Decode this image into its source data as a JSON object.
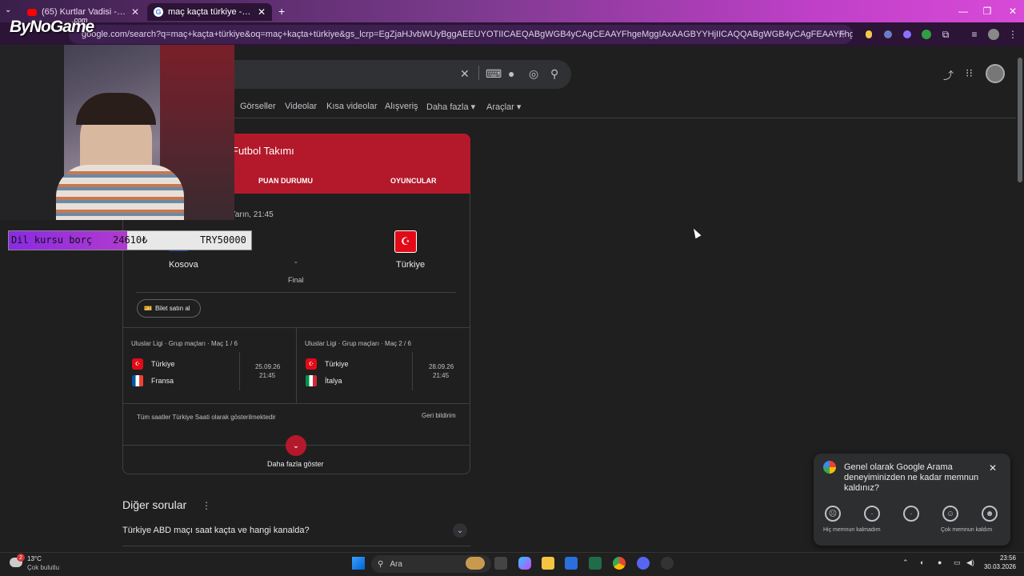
{
  "browser": {
    "tabs": [
      {
        "title": "(65) Kurtlar Vadisi - 66. Bölüm | ..."
      },
      {
        "title": "maç kaçta türkiye - Google'da A..."
      }
    ],
    "new_tab_symbol": "+",
    "url": "google.com/search?q=maç+kaçta+türkiye&oq=maç+kaçta+türkiye&gs_lcrp=EgZjaHJvbWUyBggAEEUYOTIICAEQABgWGB4yCAgCEAAYFhgeMggIAxAAGBYYHjIICAQQABgWGB4yCAgFEAAYFhgeMggIBhAAGBYYHjIICAcQABgW..."
  },
  "overlay": {
    "logo": "ByNoGame",
    "logo_sup": ".com",
    "donation": {
      "label": "Dil kursu borç",
      "current": "24610₺",
      "goal": "TRY50000",
      "progress_fraction": 0.49
    }
  },
  "search": {
    "nav_tabs": [
      "Görseller",
      "Videolar",
      "Kısa videolar",
      "Alışveriş",
      "Daha fazla",
      "Araçlar"
    ]
  },
  "match_card": {
    "title": "Futbol Takımı",
    "tabs": [
      "PUAN DURUMU",
      "OYUNCULAR"
    ],
    "date_time": "Yarın, 21:45",
    "home_team": "Kosova",
    "away_team": "Türkiye",
    "score": "-",
    "stage": "Final",
    "ticket_button": "Bilet satın al",
    "upcoming": [
      {
        "competition": "Uluslar Ligi · Grup maçları · Maç 1 / 6",
        "team1": "Türkiye",
        "team2": "Fransa",
        "date": "25.09.26",
        "time": "21:45"
      },
      {
        "competition": "Uluslar Ligi · Grup maçları · Maç 2 / 6",
        "team1": "Türkiye",
        "team2": "İtalya",
        "date": "28.09.26",
        "time": "21:45"
      }
    ],
    "timezone_note": "Tüm saatler Türkiye Saati olarak gösterilmektedir",
    "feedback_link": "Geri bildirim",
    "show_more": "Daha fazla göster"
  },
  "questions": {
    "title": "Diğer sorular",
    "items": [
      "Türkiye ABD maçı saat kaçta ve hangi kanalda?"
    ]
  },
  "feedback_popup": {
    "question": "Genel olarak Google Arama deneyiminizden ne kadar memnun kaldınız?",
    "low_label": "Hiç memnun kalmadım",
    "high_label": "Çok memnun kaldım"
  },
  "taskbar": {
    "weather_temp": "13°C",
    "weather_desc": "Çok bulutlu",
    "weather_badge": "2",
    "search_placeholder": "Ara",
    "time": "23:56",
    "date": "30.03.2026"
  }
}
